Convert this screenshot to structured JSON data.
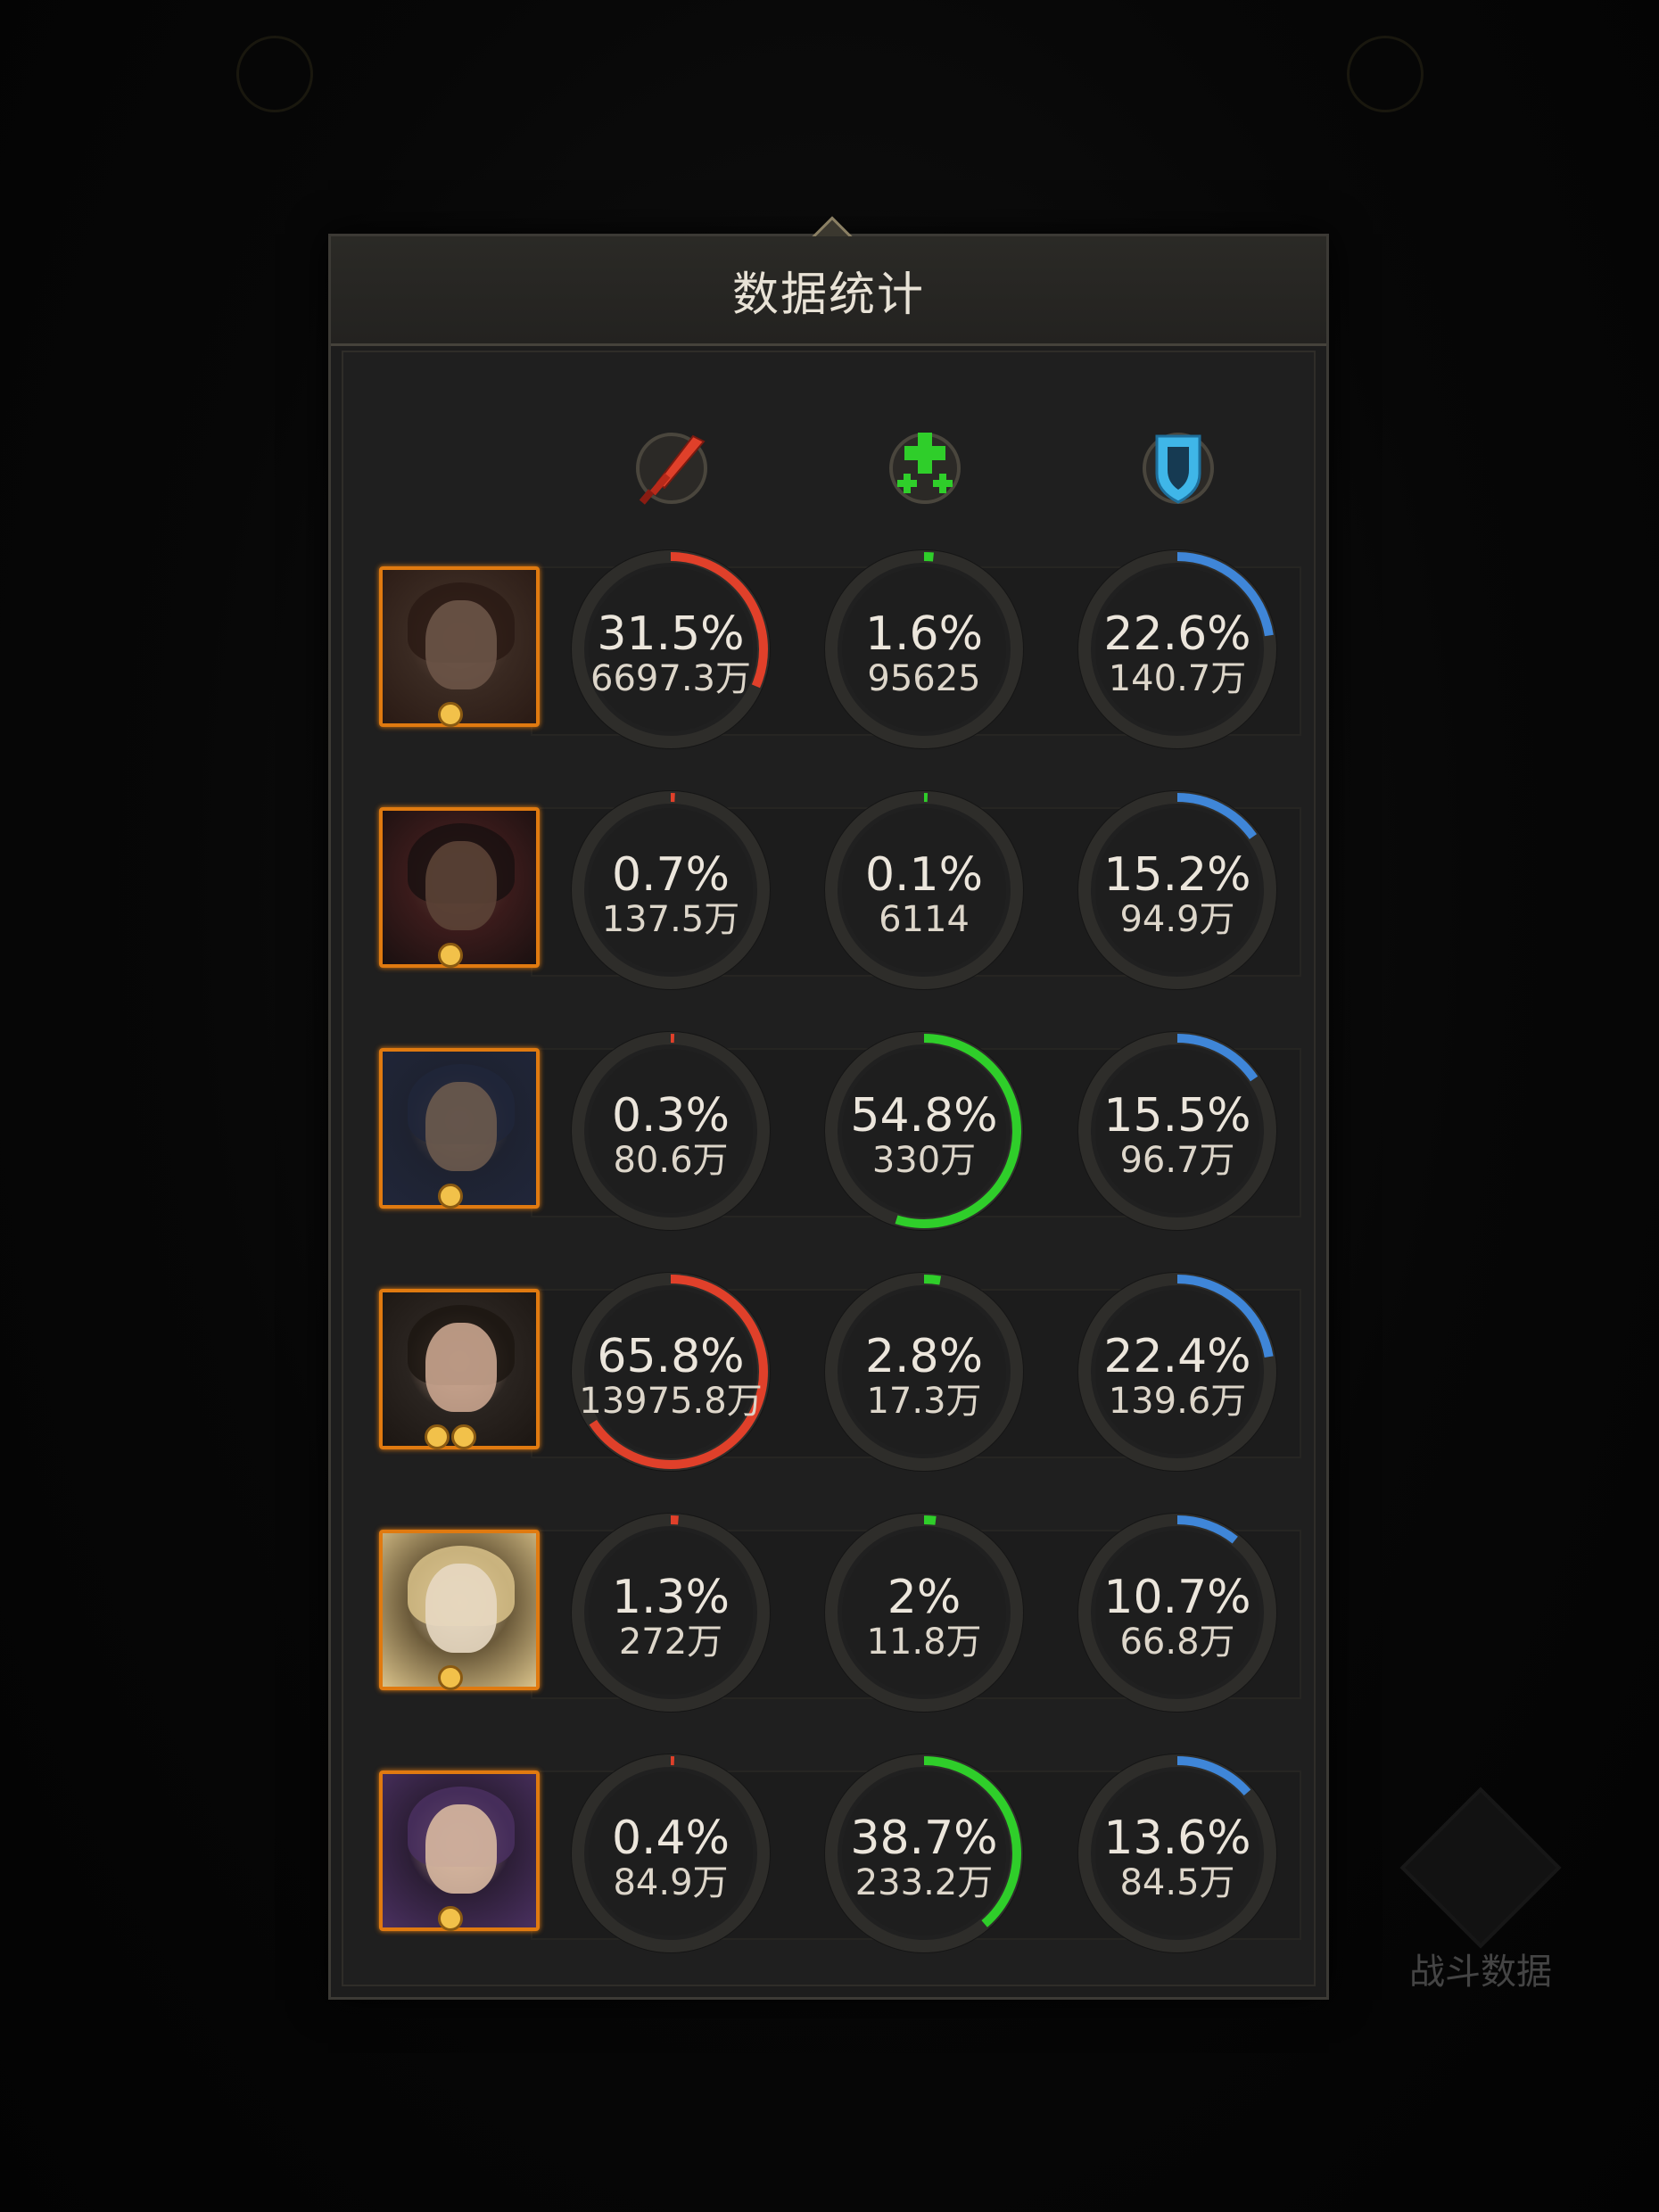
{
  "dialog": {
    "title": "数据统计"
  },
  "columns": [
    {
      "name": "damage",
      "icon": "sword-icon",
      "color": "#e0402a"
    },
    {
      "name": "healing",
      "icon": "heal-plus-icon",
      "color": "#2fce2a"
    },
    {
      "name": "damage-taken",
      "icon": "shield-icon",
      "color": "#3f86d8"
    }
  ],
  "rows": [
    {
      "hero": "hero-1",
      "stars": 1,
      "portrait_colors": [
        "#3a2a22",
        "#6b5447",
        "#2a1a14"
      ],
      "stats": [
        {
          "percent": "31.5%",
          "fraction": 0.315,
          "value": "6697.3万"
        },
        {
          "percent": "1.6%",
          "fraction": 0.016,
          "value": "95625"
        },
        {
          "percent": "22.6%",
          "fraction": 0.226,
          "value": "140.7万"
        }
      ]
    },
    {
      "hero": "hero-2",
      "stars": 1,
      "portrait_colors": [
        "#3a1b1b",
        "#5b4236",
        "#1a1010"
      ],
      "stats": [
        {
          "percent": "0.7%",
          "fraction": 0.007,
          "value": "137.5万"
        },
        {
          "percent": "0.1%",
          "fraction": 0.001,
          "value": "6114"
        },
        {
          "percent": "15.2%",
          "fraction": 0.152,
          "value": "94.9万"
        }
      ]
    },
    {
      "hero": "hero-3",
      "stars": 1,
      "portrait_colors": [
        "#1e2230",
        "#6b5a4e",
        "#20263a"
      ],
      "stats": [
        {
          "percent": "0.3%",
          "fraction": 0.003,
          "value": "80.6万"
        },
        {
          "percent": "54.8%",
          "fraction": 0.548,
          "value": "330万"
        },
        {
          "percent": "15.5%",
          "fraction": 0.155,
          "value": "96.7万"
        }
      ]
    },
    {
      "hero": "hero-4",
      "stars": 2,
      "portrait_colors": [
        "#2a2420",
        "#c9a48e",
        "#1c1612"
      ],
      "stats": [
        {
          "percent": "65.8%",
          "fraction": 0.658,
          "value": "13975.8万"
        },
        {
          "percent": "2.8%",
          "fraction": 0.028,
          "value": "17.3万"
        },
        {
          "percent": "22.4%",
          "fraction": 0.224,
          "value": "139.6万"
        }
      ]
    },
    {
      "hero": "hero-5",
      "stars": 1,
      "portrait_colors": [
        "#6b5a3a",
        "#e7d8c2",
        "#d9c28a"
      ],
      "stats": [
        {
          "percent": "1.3%",
          "fraction": 0.013,
          "value": "272万"
        },
        {
          "percent": "2%",
          "fraction": 0.02,
          "value": "11.8万"
        },
        {
          "percent": "10.7%",
          "fraction": 0.107,
          "value": "66.8万"
        }
      ]
    },
    {
      "hero": "hero-6",
      "stars": 1,
      "portrait_colors": [
        "#2c1e36",
        "#d8b8a0",
        "#4a3060"
      ],
      "stats": [
        {
          "percent": "0.4%",
          "fraction": 0.004,
          "value": "84.9万"
        },
        {
          "percent": "38.7%",
          "fraction": 0.387,
          "value": "233.2万"
        },
        {
          "percent": "13.6%",
          "fraction": 0.136,
          "value": "84.5万"
        }
      ]
    }
  ],
  "background": {
    "battle_data_label": "战斗数据"
  }
}
